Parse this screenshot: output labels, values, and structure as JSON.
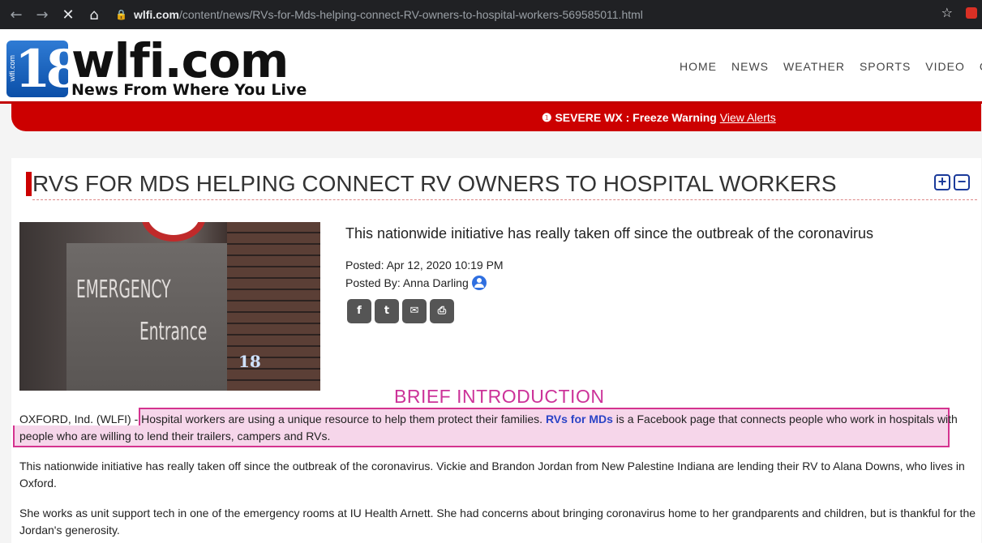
{
  "browser": {
    "back": "←",
    "forward": "→",
    "stop": "✕",
    "home": "⌂",
    "url_host": "wlfi.com",
    "url_path": "/content/news/RVs-for-Mds-helping-connect-RV-owners-to-hospital-workers-569585011.html",
    "bookmark": "☆"
  },
  "header": {
    "logo_number": "18",
    "logo_side_text": "wlfi.com",
    "wordmark": "wlfi.com",
    "tagline": "News From Where You Live",
    "nav": [
      "HOME",
      "NEWS",
      "WEATHER",
      "SPORTS",
      "VIDEO",
      "CO"
    ]
  },
  "alert": {
    "icon": "!",
    "text": "SEVERE WX : Freeze Warning",
    "link": "View Alerts"
  },
  "article": {
    "headline": "RVS FOR MDS HELPING CONNECT RV OWNERS TO HOSPITAL WORKERS",
    "zoom_in": "+",
    "zoom_out": "−",
    "image_sign_line1": "EMERGENCY",
    "image_sign_line2": "Entrance",
    "image_watermark": "18",
    "summary": "This nationwide initiative has really taken off since the outbreak of the coronavirus",
    "posted": "Posted: Apr 12, 2020 10:19 PM",
    "posted_by": "Posted By: Anna Darling",
    "share": [
      "f",
      "t",
      "✉",
      "⎙"
    ],
    "annotation": "BRIEF INTRODUCTION",
    "p1_dateline": "OXFORD, Ind. (WLFI) - ",
    "p1_text_a": "Hospital workers are using a unique resource to help them protect their families. ",
    "p1_link": "RVs for MDs",
    "p1_text_b": " is a Facebook page that connects people who work in hospitals with people who are willing to lend their trailers, campers and RVs.",
    "p2": "This nationwide initiative has really taken off since the outbreak of the coronavirus. Vickie and Brandon Jordan from New Palestine Indiana are lending their RV to Alana Downs, who lives in Oxford.",
    "p3": "She works as unit support tech in one of the emergency rooms at IU Health Arnett. She had concerns about bringing coronavirus home to her grandparents and children, but is thankful for the Jordan's generosity."
  },
  "colors": {
    "brand_red": "#cc0000",
    "link_blue": "#2b44c6",
    "annotation_pink": "#cc3399",
    "highlight_fill": "#f6d6ea"
  }
}
